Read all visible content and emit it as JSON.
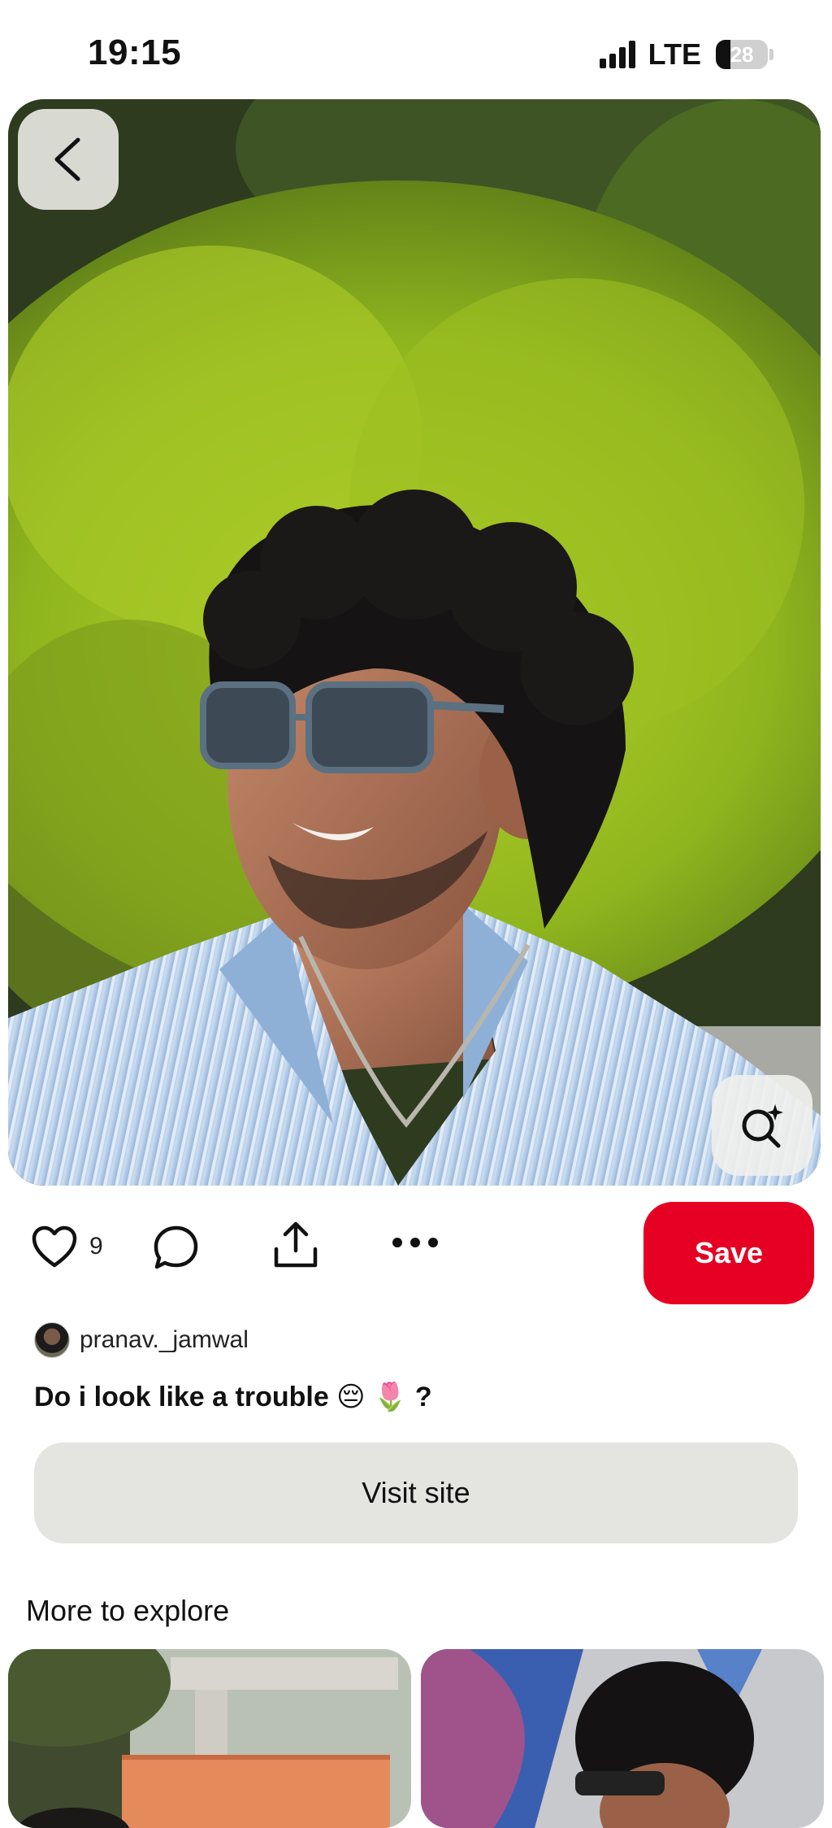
{
  "status_bar": {
    "time": "19:15",
    "network": "LTE",
    "battery": "28",
    "battery_level": 0.28
  },
  "pin": {
    "like_count": "9",
    "save_label": "Save",
    "author": "pranav._jamwal",
    "title": "Do i look like a trouble 😔 🌷 ?",
    "visit_label": "Visit site"
  },
  "explore": {
    "heading": "More to explore"
  },
  "icons": {
    "back": "chevron-left-icon",
    "lens": "visual-search-icon",
    "like": "heart-icon",
    "comment": "comment-icon",
    "share": "share-icon",
    "more": "more-icon"
  },
  "colors": {
    "save": "#e60023",
    "visit": "#e4e4e1"
  }
}
